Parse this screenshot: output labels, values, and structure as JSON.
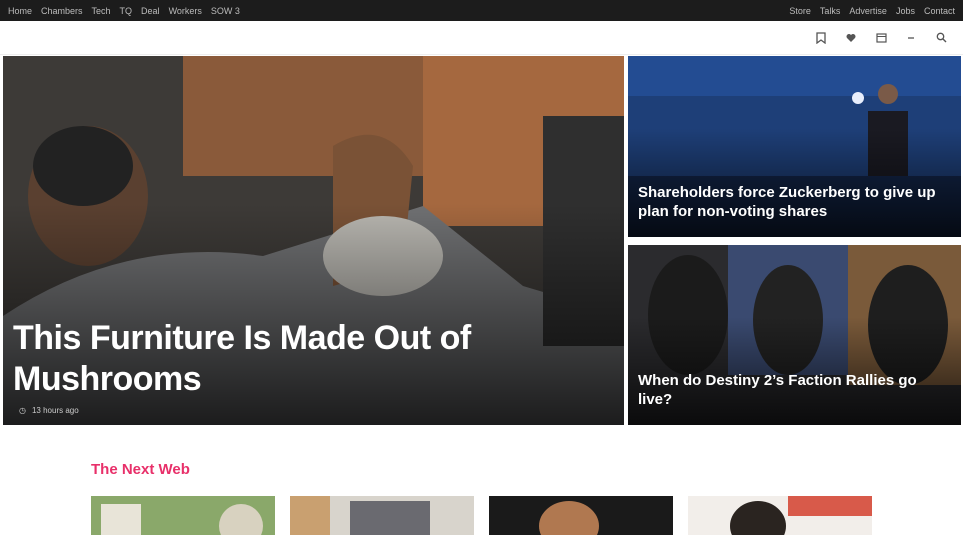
{
  "topbar": {
    "left": [
      "Home",
      "Chambers",
      "Tech",
      "TQ",
      "Deal",
      "Workers",
      "SOW 3"
    ],
    "right": [
      "Store",
      "Talks",
      "Advertise",
      "Jobs",
      "Contact"
    ]
  },
  "nav": {
    "menu": [
      "",
      "",
      ""
    ],
    "icons": [
      "bookmark-icon",
      "heart-icon",
      "calendar-icon",
      "minus-icon",
      "search-icon"
    ]
  },
  "hero": {
    "main": {
      "title": "This Furniture Is Made Out of Mushrooms",
      "meta_author": "",
      "meta_time": "13 hours ago"
    },
    "side1": {
      "title": "Shareholders force Zuckerberg to give up plan for non-voting shares",
      "meta_author": "",
      "meta_time": ""
    },
    "side2": {
      "title": "When do Destiny 2’s Faction Rallies go live?",
      "meta_author": "",
      "meta_time": ""
    }
  },
  "section": {
    "title": "The Next Web"
  },
  "colors": {
    "topbar": "#1c1c1c",
    "accent": "#e8306a"
  }
}
